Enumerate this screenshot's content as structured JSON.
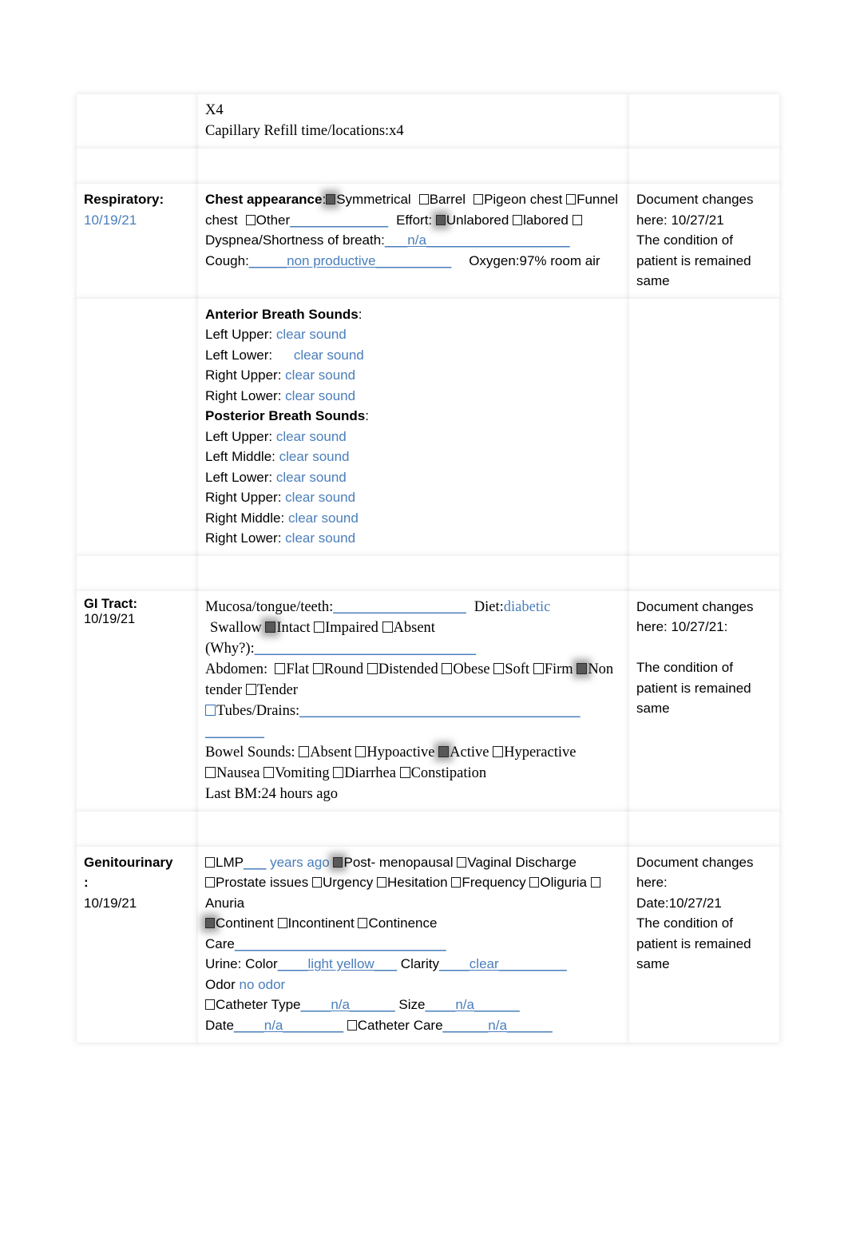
{
  "document": {
    "type": "nursing-assessment-form"
  },
  "colors": {
    "blue_text": "#4a7ebb",
    "checked_box": "#585858",
    "blue_checkbox_border": "#2f72b8"
  },
  "top_row": {
    "left": "",
    "middle_line1": "X4",
    "middle_line2": "Capillary Refill time/locations:x4",
    "right": ""
  },
  "respiratory": {
    "label": "Respiratory:",
    "date": "10/19/21",
    "chest_appearance_label": "Chest appearance",
    "chest_options": [
      {
        "label": "Symmetrical",
        "checked": true
      },
      {
        "label": "Barrel",
        "checked": false
      },
      {
        "label": "Pigeon chest",
        "checked": false
      },
      {
        "label": "Funnel chest",
        "checked": false
      },
      {
        "label": "Other",
        "checked": false
      }
    ],
    "other_blank": "_____________",
    "effort_label": "Effort:",
    "effort_options": [
      {
        "label": "Unlabored",
        "checked": true
      },
      {
        "label": "labored",
        "checked": false
      },
      {
        "label": "Dyspnea/Shortness of breath:",
        "checked": false
      }
    ],
    "breath_value": "n/a",
    "breath_blank_pre": "___",
    "breath_blank_post": "___________________",
    "cough_label": "Cough:",
    "cough_blank_pre": "_____",
    "cough_value": "non productive",
    "cough_blank_post": "__________",
    "oxygen_label": "Oxygen:",
    "oxygen_value": "97% room air",
    "anterior_title": "Anterior Breath Sounds",
    "anterior": [
      {
        "site": "Left Upper:",
        "value": "clear sound"
      },
      {
        "site": "Left Lower:",
        "value": "clear sound"
      },
      {
        "site": "Right Upper:",
        "value": "clear sound"
      },
      {
        "site": "Right Lower:",
        "value": "clear sound"
      }
    ],
    "posterior_title": "Posterior Breath Sounds",
    "posterior": [
      {
        "site": "Left Upper:",
        "value": "clear sound"
      },
      {
        "site": "Left Middle:",
        "value": "clear sound"
      },
      {
        "site": "Left Lower:",
        "value": "clear sound"
      },
      {
        "site": "Right Upper:",
        "value": "clear sound"
      },
      {
        "site": "Right Middle:",
        "value": "clear sound"
      },
      {
        "site": "Right Lower:",
        "value": "clear sound"
      }
    ],
    "notes_line1": "Document changes",
    "notes_line2": "here: 10/27/21",
    "notes_line3": "The condition of",
    "notes_line4": "patient is remained",
    "notes_line5": "same"
  },
  "gi_tract": {
    "label": "GI Tract:",
    "date": "10/19/21",
    "mucosa_label": "Mucosa/tongue/teeth:",
    "mucosa_blank": "__________________",
    "diet_label": "Diet:",
    "diet_value": "diabetic",
    "swallow_label": "Swallow",
    "swallow_options": [
      {
        "label": "Intact",
        "checked": true
      },
      {
        "label": "Impaired",
        "checked": false
      },
      {
        "label": "Absent",
        "checked": false
      }
    ],
    "why_label": "(Why?):",
    "why_blank": "______________________________",
    "abdomen_label": "Abdomen:",
    "abdomen_options": [
      {
        "label": "Flat",
        "checked": false
      },
      {
        "label": "Round",
        "checked": false
      },
      {
        "label": "Distended",
        "checked": false
      },
      {
        "label": "Obese",
        "checked": false
      },
      {
        "label": "Soft",
        "checked": false
      },
      {
        "label": "Firm",
        "checked": false
      },
      {
        "label": "Non tender",
        "checked": true
      },
      {
        "label": "Tender",
        "checked": false
      }
    ],
    "tubes_label": "Tubes/Drains:",
    "tubes_blank": "______________________________________",
    "tubes_blank2": "________",
    "bowel_label": "Bowel Sounds:",
    "bowel_options": [
      {
        "label": "Absent",
        "checked": false
      },
      {
        "label": "Hypoactive",
        "checked": false
      },
      {
        "label": "Active",
        "checked": true
      },
      {
        "label": "Hyperactive",
        "checked": false
      }
    ],
    "symptom_options": [
      {
        "label": "Nausea",
        "checked": false
      },
      {
        "label": "Vomiting",
        "checked": false
      },
      {
        "label": "Diarrhea",
        "checked": false
      },
      {
        "label": "Constipation",
        "checked": false
      }
    ],
    "last_bm_label": "Last BM:",
    "last_bm_value": "24 hours ago",
    "notes_line1": "Document changes",
    "notes_line2": "here: 10/27/21:",
    "notes_line3": "The condition of",
    "notes_line4": "patient is remained",
    "notes_line5": "same"
  },
  "genitourinary": {
    "label": "Genitourinary",
    "label_colon": ":",
    "date": "10/19/21",
    "lmp_label": "LMP",
    "lmp_blank": "___",
    "lmp_value": "years ago",
    "row1_options": [
      {
        "label": "LMP",
        "checked": false
      },
      {
        "label": "Post- menopausal",
        "checked": true
      },
      {
        "label": "Vaginal Discharge",
        "checked": false
      }
    ],
    "row2_options": [
      {
        "label": "Prostate issues",
        "checked": false
      },
      {
        "label": "Urgency",
        "checked": false
      },
      {
        "label": "Hesitation",
        "checked": false
      },
      {
        "label": "Frequency",
        "checked": false
      },
      {
        "label": "Oliguria",
        "checked": false
      },
      {
        "label": "Anuria",
        "checked": false
      }
    ],
    "row3_options": [
      {
        "label": "Continent",
        "checked": true
      },
      {
        "label": "Incontinent",
        "checked": false
      },
      {
        "label": "Continence Care",
        "checked": false
      }
    ],
    "care_blank": "____________________________",
    "urine_label": "Urine: Color",
    "urine_color_pre": "____",
    "urine_color_value": "light yellow",
    "urine_color_post": "___",
    "clarity_label": "Clarity",
    "clarity_pre": "____",
    "clarity_value": "clear",
    "clarity_post": "_________",
    "odor_label": "Odor",
    "odor_value": "no odor",
    "catheter_type_label": "Catheter Type",
    "catheter_type_pre": "____",
    "catheter_type_value": "n/a",
    "catheter_type_post": "______",
    "size_label": "Size",
    "size_pre": "____",
    "size_value": "n/a",
    "size_post": "______",
    "cath_date_label": "Date",
    "cath_date_pre": "____",
    "cath_date_value": "n/a",
    "cath_date_post": "________",
    "catheter_care_label": "Catheter Care",
    "catheter_care_pre": "______",
    "catheter_care_value": "n/a",
    "catheter_care_post": "______",
    "notes_line1": "Document changes",
    "notes_line2": "here:",
    "notes_line3": "Date:10/27/21",
    "notes_line4": "The condition of",
    "notes_line5": "patient is remained",
    "notes_line6": "same"
  }
}
